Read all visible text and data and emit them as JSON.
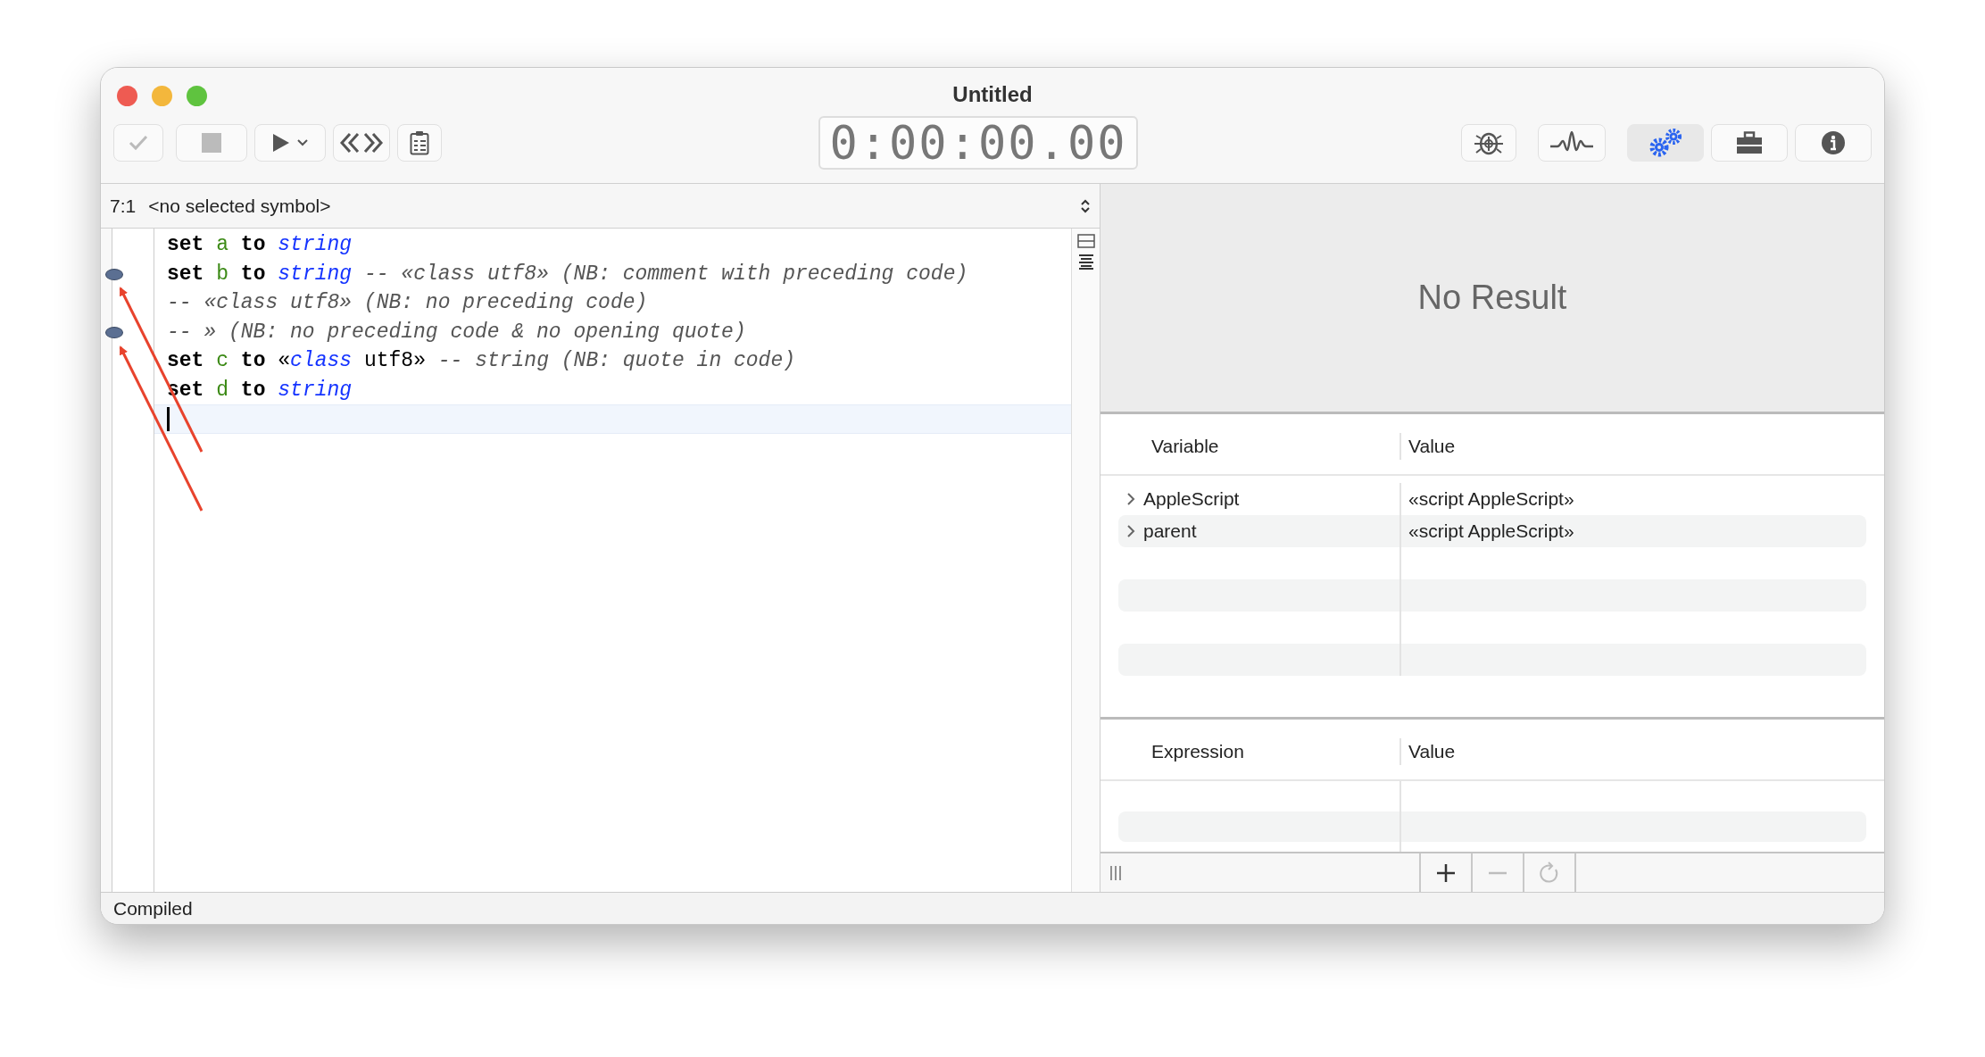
{
  "window": {
    "title": "Untitled"
  },
  "toolbar": {
    "left_buttons": [
      {
        "kind": "compile",
        "disabled": true
      },
      {
        "kind": "stop",
        "disabled": true
      },
      {
        "kind": "run",
        "disabled": false
      },
      {
        "kind": "format",
        "disabled": false
      },
      {
        "kind": "clipboard",
        "disabled": false
      }
    ],
    "timer": "0:00:00.00",
    "right_buttons": [
      {
        "kind": "bug",
        "selected": false
      },
      {
        "kind": "wave",
        "selected": false
      },
      {
        "kind": "gears",
        "selected": true
      },
      {
        "kind": "briefcase",
        "selected": false
      },
      {
        "kind": "info",
        "selected": false
      }
    ]
  },
  "symbol_bar": {
    "position": "7:1",
    "symbol": "<no selected symbol>"
  },
  "code": {
    "lines": [
      {
        "breakpoint": false,
        "current": false,
        "segments": [
          {
            "kind": "keyword",
            "text": "set"
          },
          {
            "kind": "variable",
            "text": "a"
          },
          {
            "kind": "keyword",
            "text": "to"
          },
          {
            "kind": "class",
            "text": "string"
          }
        ]
      },
      {
        "breakpoint": true,
        "current": false,
        "segments": [
          {
            "kind": "keyword",
            "text": "set"
          },
          {
            "kind": "variable",
            "text": "b"
          },
          {
            "kind": "keyword",
            "text": "to"
          },
          {
            "kind": "class",
            "text": "string"
          },
          {
            "kind": "comment",
            "text": "-- «class utf8» (NB: comment with preceding code)"
          }
        ]
      },
      {
        "breakpoint": false,
        "current": false,
        "segments": [
          {
            "kind": "comment",
            "text": "-- «class utf8» (NB: no preceding code)"
          }
        ]
      },
      {
        "breakpoint": true,
        "current": false,
        "segments": [
          {
            "kind": "comment",
            "text": "-- » (NB: no preceding code & no opening quote)"
          }
        ]
      },
      {
        "breakpoint": false,
        "current": false,
        "segments": [
          {
            "kind": "keyword",
            "text": "set"
          },
          {
            "kind": "variable",
            "text": "c"
          },
          {
            "kind": "keyword",
            "text": "to"
          },
          {
            "kind": "plain",
            "text": "«"
          },
          {
            "kind": "class",
            "text": "class",
            "attached": true
          },
          {
            "kind": "plain",
            "text": "utf8»"
          },
          {
            "kind": "comment",
            "text": "-- string (NB: quote in code)"
          }
        ]
      },
      {
        "breakpoint": false,
        "current": false,
        "segments": [
          {
            "kind": "keyword",
            "text": "set"
          },
          {
            "kind": "variable",
            "text": "d"
          },
          {
            "kind": "keyword",
            "text": "to"
          },
          {
            "kind": "class",
            "text": "string"
          }
        ]
      },
      {
        "breakpoint": false,
        "current": true
      }
    ]
  },
  "result": {
    "text": "No Result"
  },
  "variables": {
    "columns": [
      "Variable",
      "Value"
    ],
    "rows": [
      {
        "name": "AppleScript",
        "value": "«script AppleScript»",
        "expanded": false
      },
      {
        "name": "parent",
        "value": "«script AppleScript»",
        "expanded": false
      }
    ]
  },
  "expressions": {
    "columns": [
      "Expression",
      "Value"
    ]
  },
  "expression_bar": {
    "buttons": [
      {
        "kind": "add",
        "disabled": false
      },
      {
        "kind": "remove",
        "disabled": true
      },
      {
        "kind": "refresh",
        "disabled": true
      }
    ]
  },
  "status_bar": "Compiled"
}
